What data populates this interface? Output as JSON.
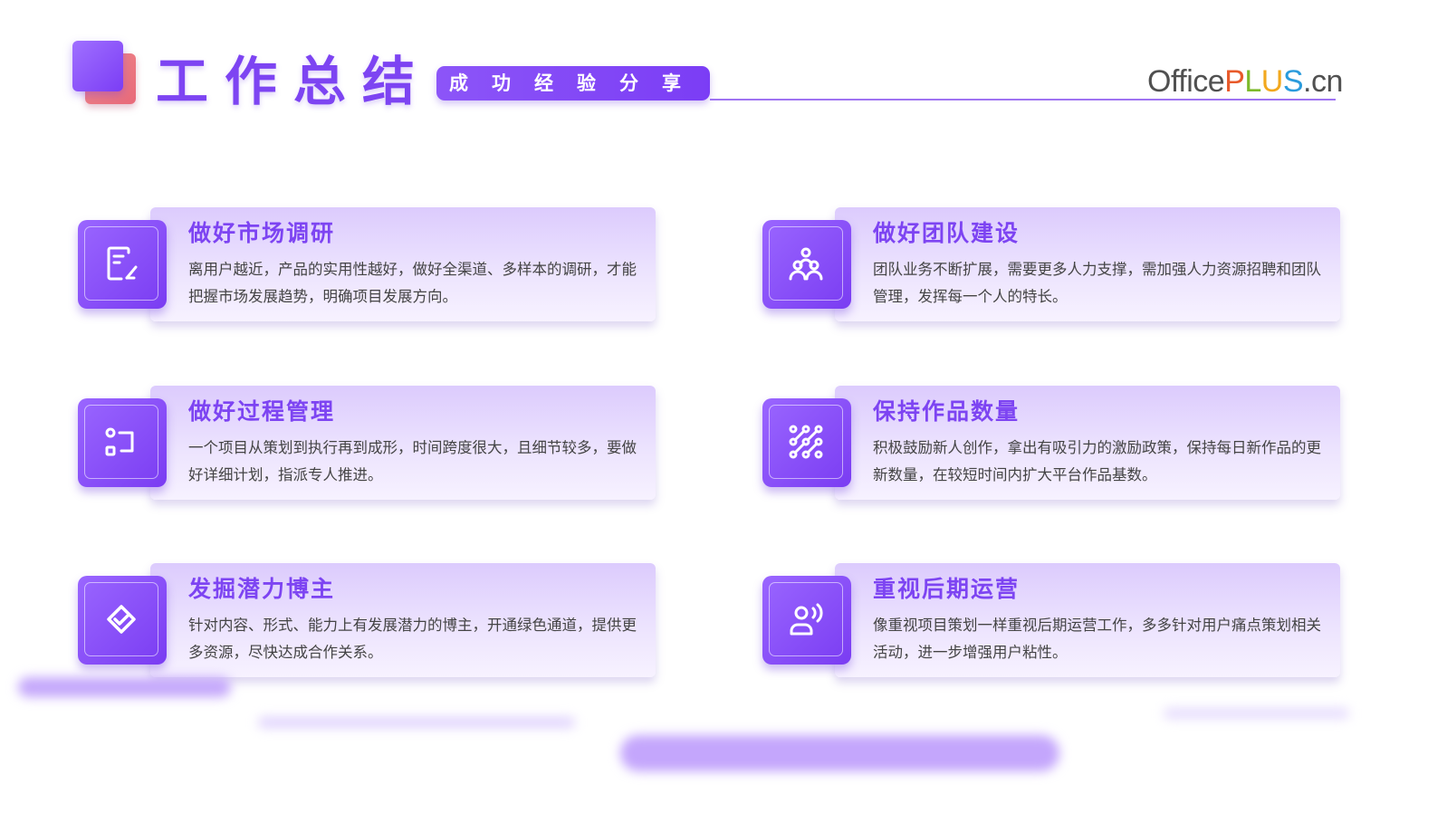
{
  "header": {
    "title": "工作总结",
    "subtitle": "成功经验分享",
    "brand": {
      "office": "Office",
      "p": "P",
      "l": "L",
      "u": "U",
      "s": "S",
      "cn": ".cn"
    }
  },
  "colors": {
    "accent": "#7d44f2",
    "icon_gradient_start": "#9a66ff",
    "icon_gradient_end": "#7a3cf2"
  },
  "cards": [
    {
      "icon": "edit-document-icon",
      "title": "做好市场调研",
      "desc": "离用户越近，产品的实用性越好，做好全渠道、多样本的调研，才能把握市场发展趋势，明确项目发展方向。"
    },
    {
      "icon": "team-people-icon",
      "title": "做好团队建设",
      "desc": "团队业务不断扩展，需要更多人力支撑，需加强人力资源招聘和团队管理，发挥每一个人的特长。"
    },
    {
      "icon": "process-flow-icon",
      "title": "做好过程管理",
      "desc": "一个项目从策划到执行再到成形，时间跨度很大，且细节较多，要做好详细计划，指派专人推进。"
    },
    {
      "icon": "data-dots-icon",
      "title": "保持作品数量",
      "desc": "积极鼓励新人创作，拿出有吸引力的激励政策，保持每日新作品的更新数量，在较短时间内扩大平台作品基数。"
    },
    {
      "icon": "diamond-handshake-icon",
      "title": "发掘潜力博主",
      "desc": "针对内容、形式、能力上有发展潜力的博主，开通绿色通道，提供更多资源，尽快达成合作关系。"
    },
    {
      "icon": "user-speaking-icon",
      "title": "重视后期运营",
      "desc": "像重视项目策划一样重视后期运营工作，多多针对用户痛点策划相关活动，进一步增强用户粘性。"
    }
  ]
}
